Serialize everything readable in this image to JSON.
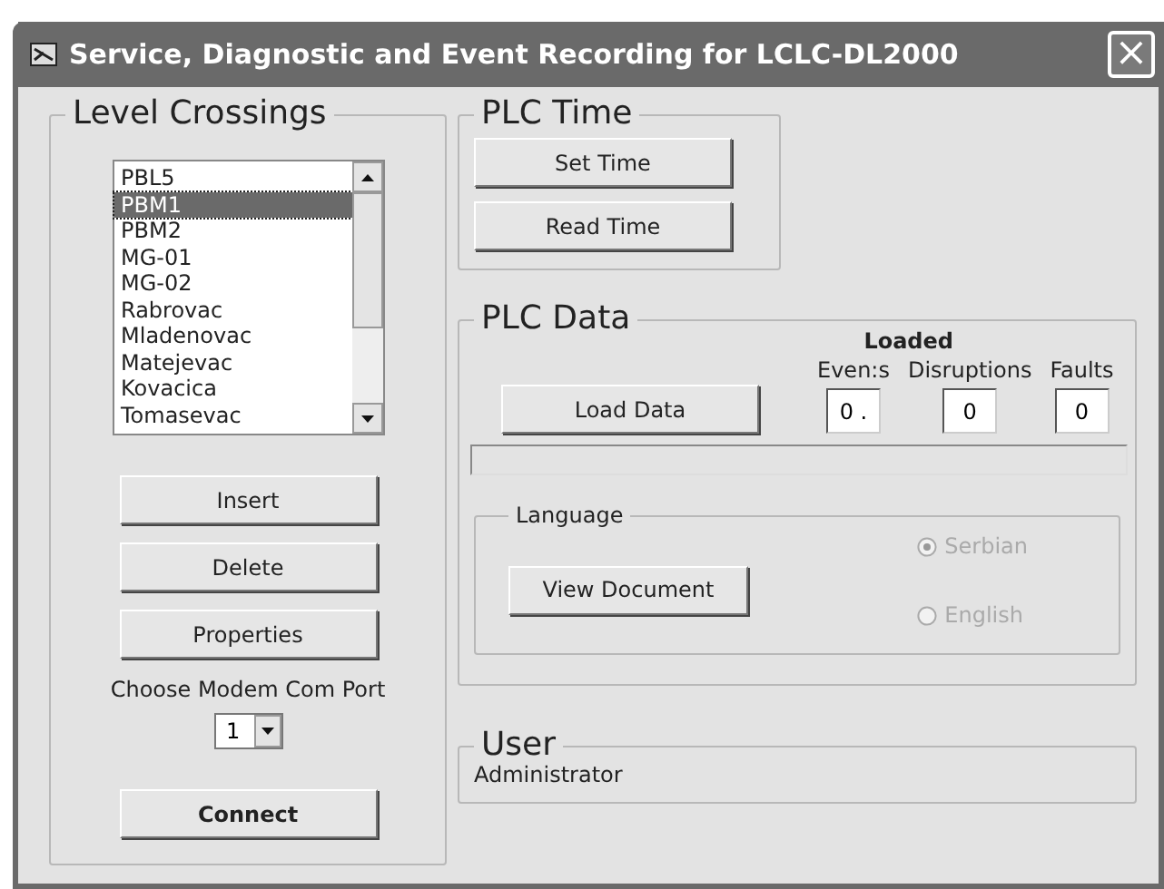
{
  "window": {
    "title": "Service, Diagnostic and Event Recording for LCLC-DL2000",
    "close": "×"
  },
  "level_crossings": {
    "title": "Level Crossings",
    "items": [
      {
        "label": "PBL5",
        "selected": false
      },
      {
        "label": "PBM1",
        "selected": true
      },
      {
        "label": "PBM2",
        "selected": false
      },
      {
        "label": "MG-01",
        "selected": false
      },
      {
        "label": "MG-02",
        "selected": false
      },
      {
        "label": "Rabrovac",
        "selected": false
      },
      {
        "label": "Mladenovac",
        "selected": false
      },
      {
        "label": "Matejevac",
        "selected": false
      },
      {
        "label": "Kovacica",
        "selected": false
      },
      {
        "label": "Tomasevac",
        "selected": false
      }
    ],
    "buttons": [
      "Insert",
      "Delete",
      "Properties"
    ],
    "com_port": {
      "label": "Choose Modem Com Port",
      "value": "1"
    },
    "connect": "Connect"
  },
  "plc_time": {
    "title": "PLC Time",
    "buttons": [
      "Set Time",
      "Read Time"
    ]
  },
  "plc_data": {
    "title": "PLC Data",
    "load_button": "Load Data",
    "loaded_heading": "Loaded",
    "counters": [
      {
        "label": "Even:s",
        "value": "0 ."
      },
      {
        "label": "Disruptions",
        "value": "0"
      },
      {
        "label": "Faults",
        "value": "0"
      }
    ],
    "progress": {
      "level": 0
    },
    "language": {
      "title": "Language",
      "view_button": "View Document",
      "options": [
        {
          "label": "Serbian",
          "selected": true,
          "disabled": true
        },
        {
          "label": "English",
          "selected": false,
          "disabled": true
        }
      ]
    }
  },
  "user": {
    "title": "User",
    "name": "Administrator"
  }
}
